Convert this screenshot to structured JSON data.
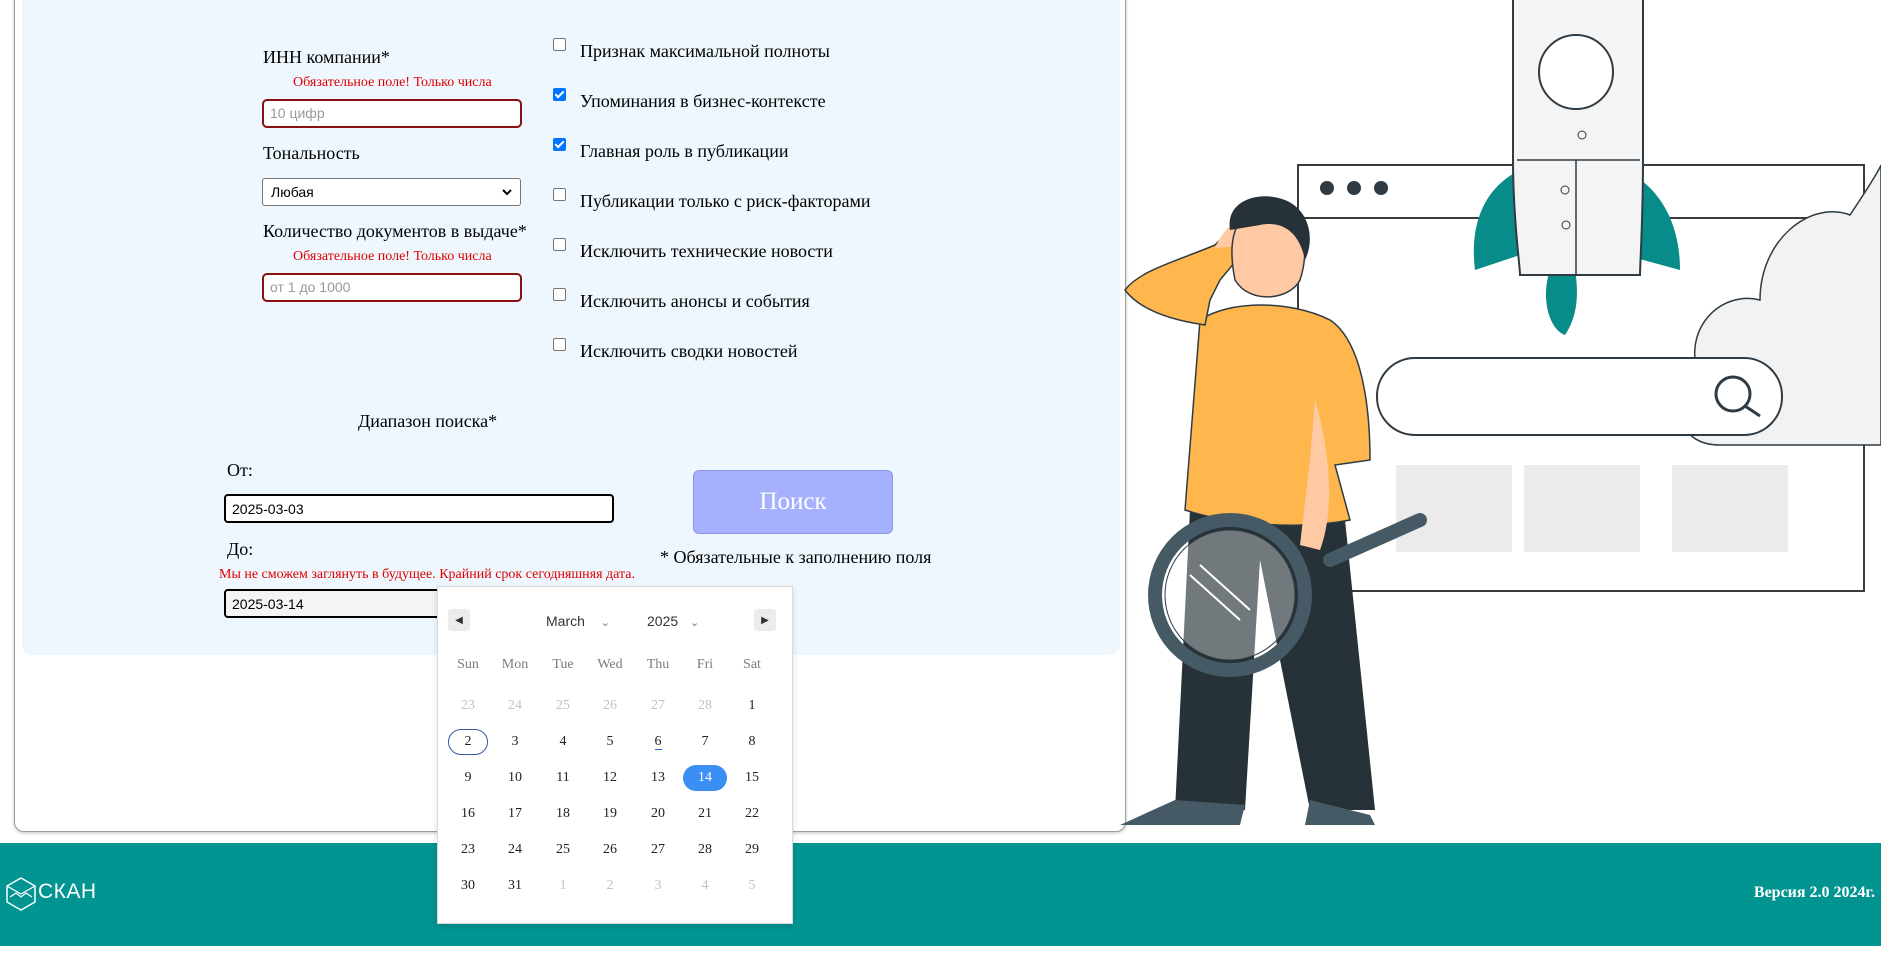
{
  "form": {
    "inn_label": "ИНН компании*",
    "inn_error": "Обязательное поле! Только числа",
    "inn_placeholder": "10 цифр",
    "tone_label": "Тональность",
    "tone_value": "Любая",
    "docs_label": "Количество документов в выдаче*",
    "docs_error": "Обязательное поле! Только числа",
    "docs_placeholder": "от 1 до 1000",
    "range_label": "Диапазон поиска*",
    "from_label": "От:",
    "from_value": "2025-03-03",
    "to_label": "До:",
    "to_error": "Мы не сможем заглянуть в будущее. Крайний срок сегодняшняя дата.",
    "to_value": "2025-03-14",
    "search_button": "Поиск",
    "required_note": "* Обязательные к заполнению поля"
  },
  "checkboxes": [
    {
      "label": "Признак максимальной полноты",
      "checked": false
    },
    {
      "label": "Упоминания в бизнес-контексте",
      "checked": true
    },
    {
      "label": "Главная роль в публикации",
      "checked": true
    },
    {
      "label": "Публикации только с риск-факторами",
      "checked": false
    },
    {
      "label": "Исключить технические новости",
      "checked": false
    },
    {
      "label": "Исключить анонсы и события",
      "checked": false
    },
    {
      "label": "Исключить сводки новостей",
      "checked": false
    }
  ],
  "calendar": {
    "month": "March",
    "year": "2025",
    "weekdays": [
      "Sun",
      "Mon",
      "Tue",
      "Wed",
      "Thu",
      "Fri",
      "Sat"
    ],
    "weeks": [
      [
        "23",
        "24",
        "25",
        "26",
        "27",
        "28",
        "1"
      ],
      [
        "2",
        "3",
        "4",
        "5",
        "6",
        "7",
        "8"
      ],
      [
        "9",
        "10",
        "11",
        "12",
        "13",
        "14",
        "15"
      ],
      [
        "16",
        "17",
        "18",
        "19",
        "20",
        "21",
        "22"
      ],
      [
        "23",
        "24",
        "25",
        "26",
        "27",
        "28",
        "29"
      ],
      [
        "30",
        "31",
        "1",
        "2",
        "3",
        "4",
        "5"
      ]
    ],
    "selected_day": "14",
    "focused_day": "2",
    "today_day": "6"
  },
  "footer": {
    "logo_text": "СКАН",
    "version": "Версия 2.0 2024г."
  },
  "colors": {
    "accent": "#029491",
    "error": "#e00000",
    "button": "#a5b0ff",
    "selected_day": "#3b8ef3"
  }
}
